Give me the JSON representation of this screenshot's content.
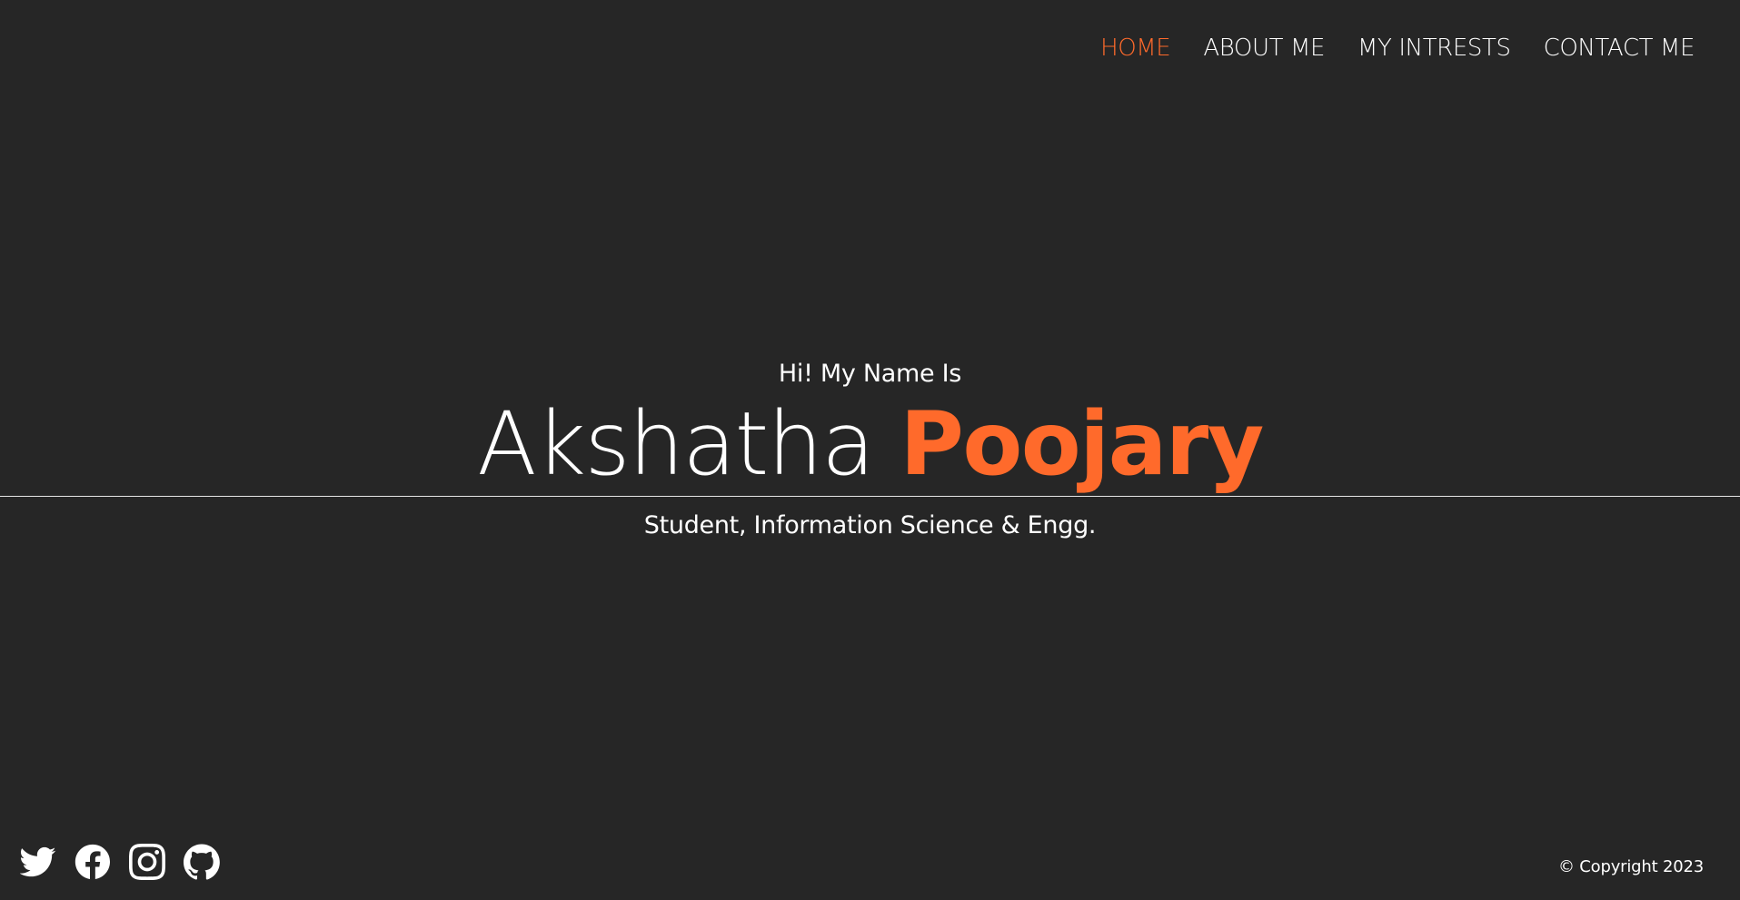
{
  "nav": {
    "items": [
      {
        "label": "HOME",
        "active": true
      },
      {
        "label": "ABOUT ME",
        "active": false
      },
      {
        "label": "MY INTRESTS",
        "active": false
      },
      {
        "label": "CONTACT ME",
        "active": false
      }
    ]
  },
  "hero": {
    "greeting": "Hi! My Name Is",
    "first_name": "Akshatha",
    "last_name": "Poojary",
    "subtitle": "Student, Information Science & Engg."
  },
  "footer": {
    "socials": [
      {
        "icon": "twitter-icon"
      },
      {
        "icon": "facebook-icon"
      },
      {
        "icon": "instagram-icon"
      },
      {
        "icon": "github-icon"
      }
    ],
    "copyright": "© Copyright 2023"
  },
  "colors": {
    "background": "#262626",
    "accent": "#ff6a2b",
    "text": "#ffffff"
  }
}
